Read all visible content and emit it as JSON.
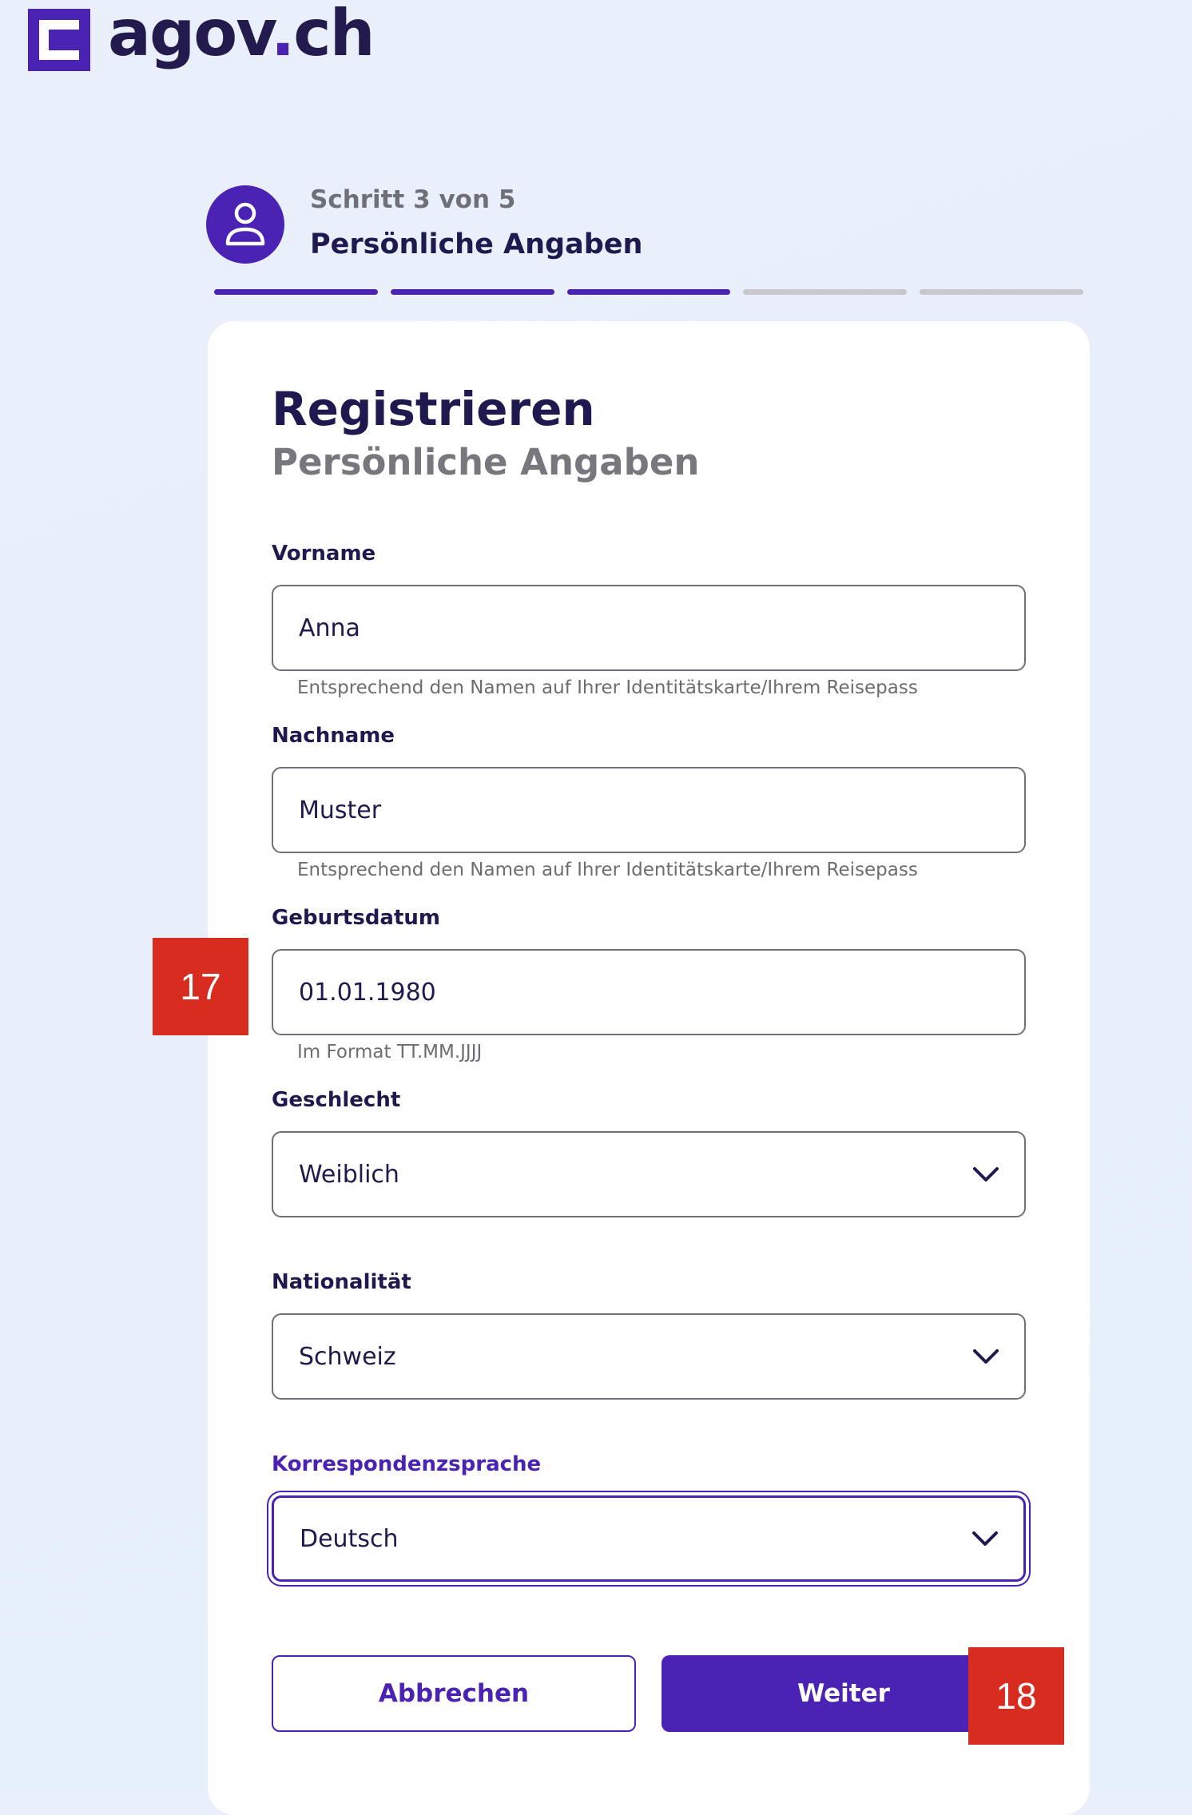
{
  "brand": {
    "name_main": "agov",
    "name_dot": ".",
    "name_tld": "ch",
    "accent_color": "#4a22b4",
    "logo_icon": "agov-logo-icon"
  },
  "stepper": {
    "step_label": "Schritt 3 von 5",
    "step_title": "Persönliche Angaben",
    "icon": "user-icon",
    "current_step": 3,
    "total_steps": 5
  },
  "form": {
    "title": "Registrieren",
    "subtitle": "Persönliche Angaben",
    "first_name": {
      "label": "Vorname",
      "value": "Anna",
      "hint": "Entsprechend den Namen auf Ihrer Identitätskarte/Ihrem Reisepass"
    },
    "last_name": {
      "label": "Nachname",
      "value": "Muster",
      "hint": "Entsprechend den Namen auf Ihrer Identitätskarte/Ihrem Reisepass"
    },
    "birth_date": {
      "label": "Geburtsdatum",
      "value": "01.01.1980",
      "hint": "Im Format TT.MM.JJJJ"
    },
    "gender": {
      "label": "Geschlecht",
      "value": "Weiblich",
      "icon": "chevron-down-icon"
    },
    "nationality": {
      "label": "Nationalität",
      "value": "Schweiz",
      "icon": "chevron-down-icon"
    },
    "language": {
      "label": "Korrespondenzsprache",
      "value": "Deutsch",
      "icon": "chevron-down-icon",
      "focused": true
    },
    "cancel_label": "Abbrechen",
    "next_label": "Weiter"
  },
  "markers": {
    "birth_date_marker": "17",
    "next_button_marker": "18",
    "marker_color": "#d92c20"
  }
}
